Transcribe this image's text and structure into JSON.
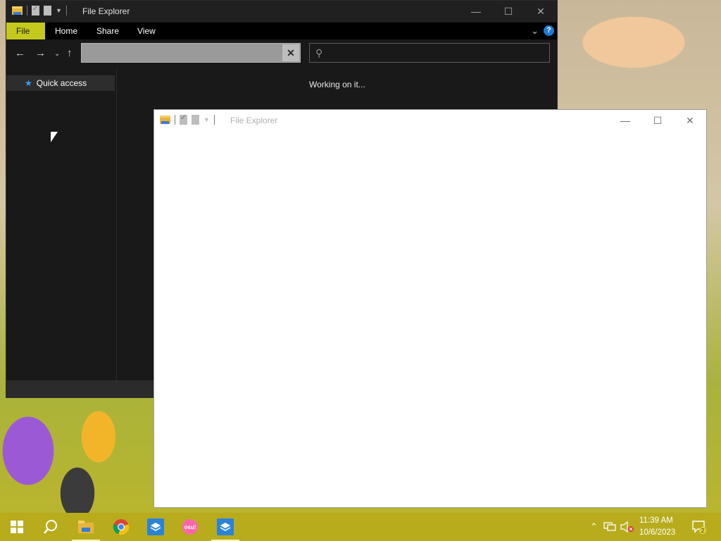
{
  "back_window": {
    "title": "File Explorer",
    "ribbon_tabs": [
      "File",
      "Home",
      "Share",
      "View"
    ],
    "address_value": "",
    "search_placeholder": "",
    "nav_items": [
      {
        "label": "Quick access",
        "icon": "star-icon"
      }
    ],
    "content_message": "Working on it..."
  },
  "front_window": {
    "title": "File Explorer"
  },
  "taskbar": {
    "apps": [
      "start-icon",
      "search-icon",
      "file-explorer-icon",
      "chrome-icon",
      "app-icon",
      "osu-icon",
      "app-icon"
    ],
    "osu_label": "osu!",
    "time": "11:39 AM",
    "date": "10/6/2023",
    "notification_count": "2"
  },
  "colors": {
    "accent_file_tab": "#c4c91b",
    "taskbar": "#b8ac1d",
    "help_blue": "#1f7ad6"
  }
}
